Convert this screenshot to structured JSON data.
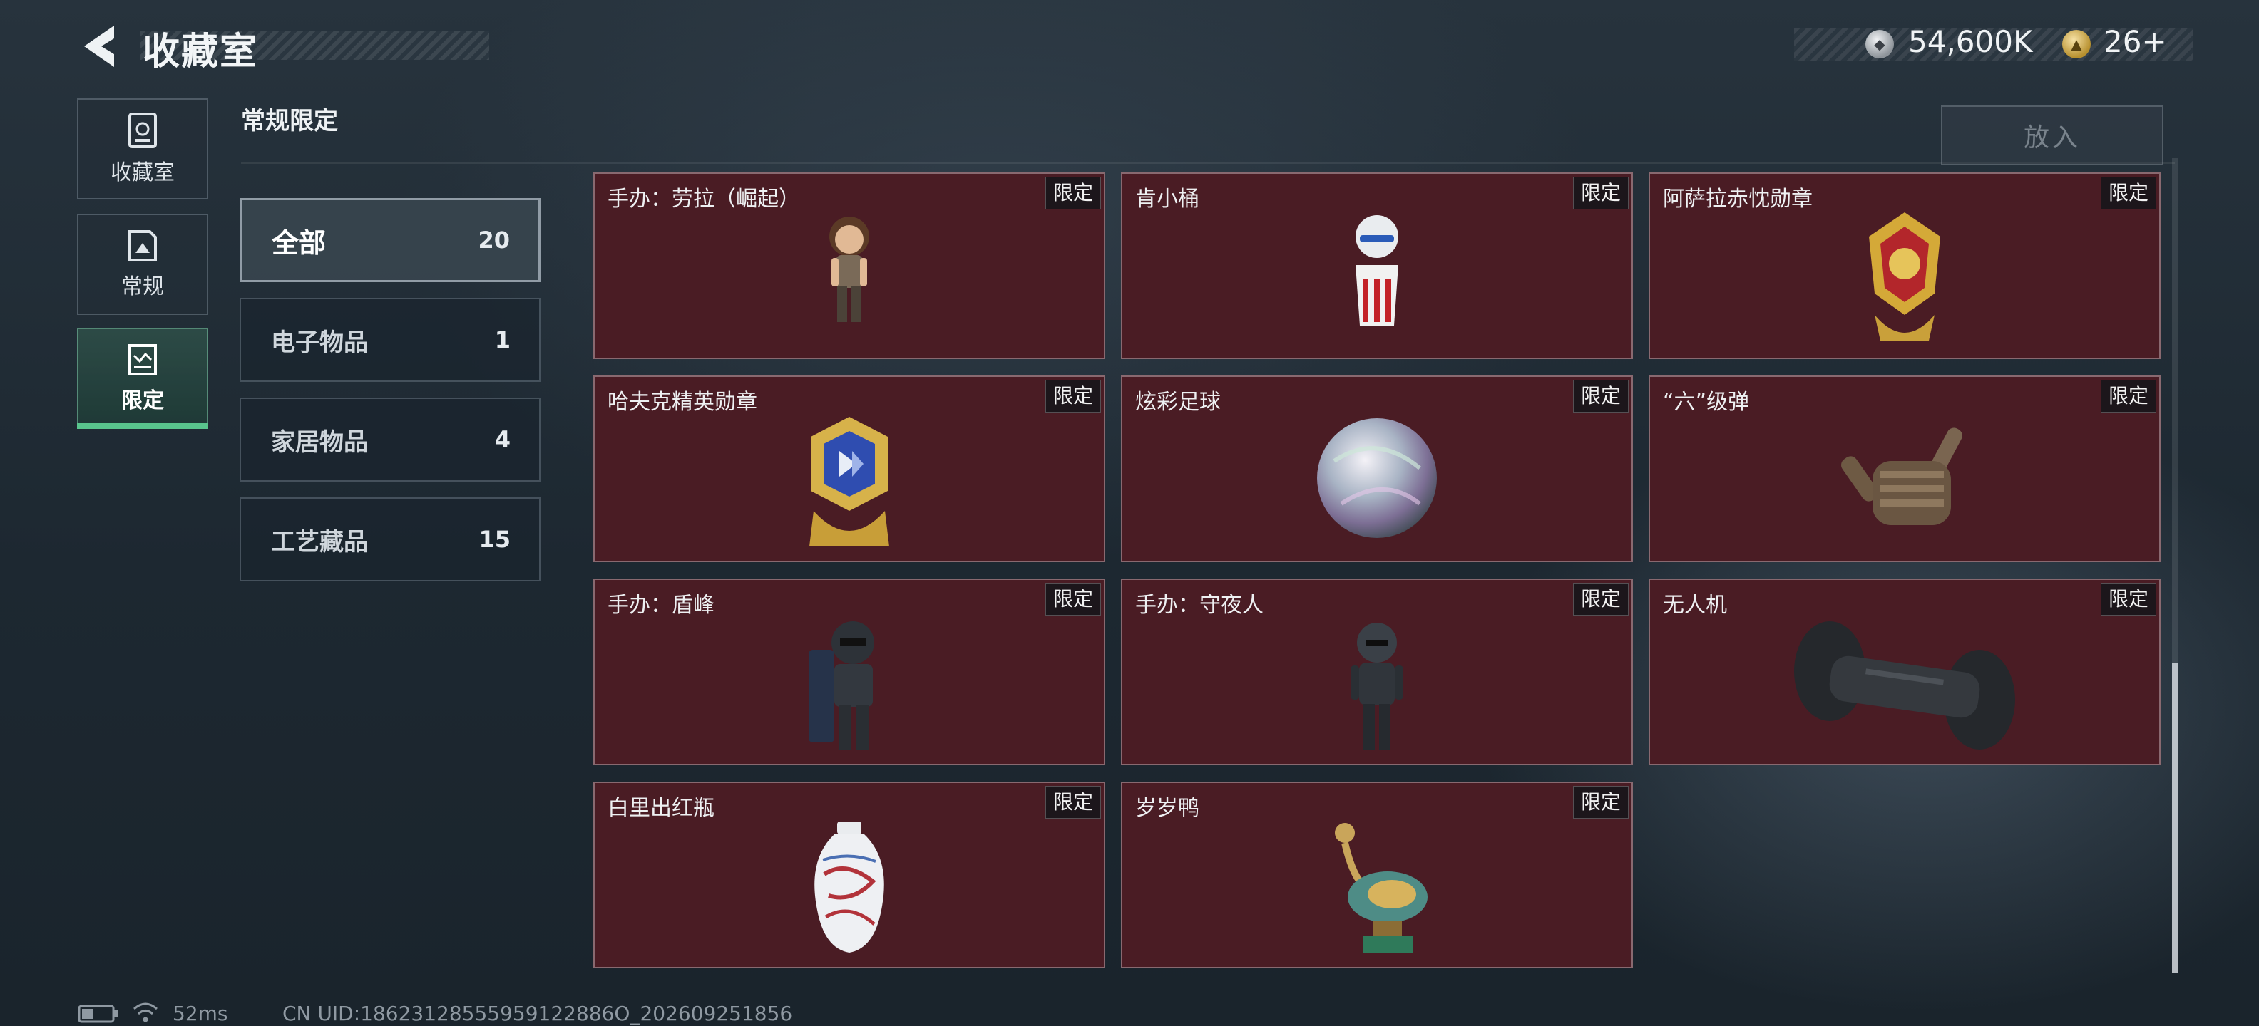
{
  "header": {
    "title": "收藏室",
    "currency": [
      {
        "icon": "silver-coin-icon",
        "value": "54,600K"
      },
      {
        "icon": "gold-coin-icon",
        "value": "26+"
      }
    ]
  },
  "nav": [
    {
      "label": "收藏室",
      "icon": "collection-room-icon",
      "active": false
    },
    {
      "label": "常规",
      "icon": "regular-icon",
      "active": false
    },
    {
      "label": "限定",
      "icon": "limited-icon",
      "active": true
    }
  ],
  "section": {
    "title": "常规限定",
    "put_button": "放入"
  },
  "categories": [
    {
      "label": "全部",
      "count": "20",
      "active": true
    },
    {
      "label": "电子物品",
      "count": "1",
      "active": false
    },
    {
      "label": "家居物品",
      "count": "4",
      "active": false
    },
    {
      "label": "工艺藏品",
      "count": "15",
      "active": false
    }
  ],
  "items": [
    {
      "name": "手办：劳拉（崛起）",
      "tag": "限定",
      "art": "figure-lara-icon"
    },
    {
      "name": "肯小桶",
      "tag": "限定",
      "art": "kfc-figure-icon"
    },
    {
      "name": "阿萨拉赤忱勋章",
      "tag": "限定",
      "art": "red-medal-icon"
    },
    {
      "name": "哈夫克精英勋章",
      "tag": "限定",
      "art": "blue-medal-icon"
    },
    {
      "name": "炫彩足球",
      "tag": "限定",
      "art": "iridescent-ball-icon"
    },
    {
      "name": "“六”级弹",
      "tag": "限定",
      "art": "bullet-hand-icon"
    },
    {
      "name": "手办：盾峰",
      "tag": "限定",
      "art": "shield-figure-icon"
    },
    {
      "name": "手办：守夜人",
      "tag": "限定",
      "art": "nightwatch-figure-icon"
    },
    {
      "name": "无人机",
      "tag": "限定",
      "art": "drone-icon"
    },
    {
      "name": "白里出红瓶",
      "tag": "限定",
      "art": "porcelain-vase-icon"
    },
    {
      "name": "岁岁鸭",
      "tag": "限定",
      "art": "bronze-duck-icon"
    }
  ],
  "footer": {
    "ping": "52ms",
    "uid": "CN UID:18623128555959122886O_202609251856"
  }
}
